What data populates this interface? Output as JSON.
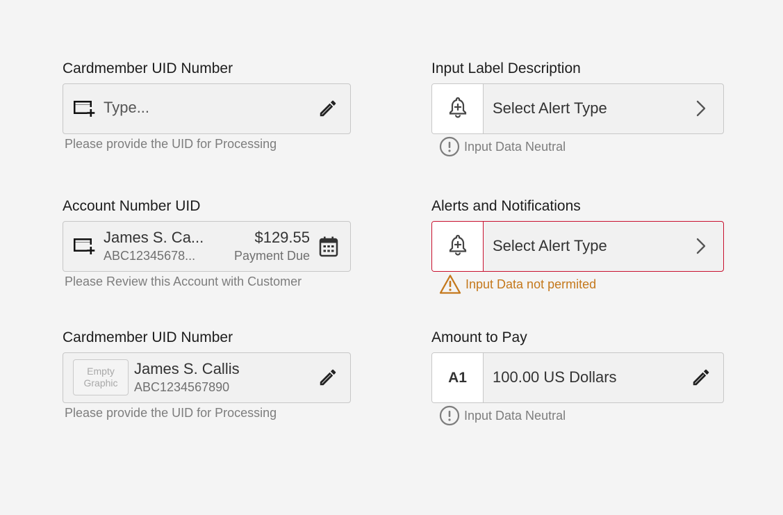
{
  "left_column": {
    "field1": {
      "label": "Cardmember UID Number",
      "placeholder": "Type...",
      "helper": "Please provide the UID for Processing",
      "lead_icon": "card-plus-icon",
      "trail_icon": "pencil-icon"
    },
    "field2": {
      "label": "Account Number UID",
      "name": "James S. Ca...",
      "account": "ABC12345678...",
      "amount": "$129.55",
      "amount_caption": "Payment Due",
      "helper": "Please Review this Account with Customer",
      "lead_icon": "card-plus-icon",
      "trail_icon": "calendar-icon"
    },
    "field3": {
      "label": "Cardmember UID Number",
      "graphic_line1": "Empty",
      "graphic_line2": "Graphic",
      "name": "James S. Callis",
      "account": "ABC1234567890",
      "helper": "Please provide the UID for Processing",
      "trail_icon": "pencil-icon"
    }
  },
  "right_column": {
    "field1": {
      "label": "Input Label Description",
      "value": "Select Alert Type",
      "status": "Input Data Neutral",
      "status_icon": "exclamation-circle-icon",
      "prefix_icon": "bell-plus-icon",
      "trail_icon": "chevron-right-icon"
    },
    "field2": {
      "label": "Alerts and Notifications",
      "value": "Select Alert Type",
      "status": "Input Data not permited",
      "status_icon": "warning-triangle-icon",
      "prefix_icon": "bell-plus-icon",
      "trail_icon": "chevron-right-icon"
    },
    "field3": {
      "label": "Amount to Pay",
      "prefix": "A1",
      "value": "100.00 US Dollars",
      "status": "Input Data Neutral",
      "status_icon": "exclamation-circle-icon",
      "trail_icon": "pencil-icon"
    }
  },
  "colors": {
    "background": "#f4f4f4",
    "border": "#c7c7c7",
    "error_border": "#c8102e",
    "warning_text": "#c4781c",
    "helper_text": "#7d7d7d"
  }
}
